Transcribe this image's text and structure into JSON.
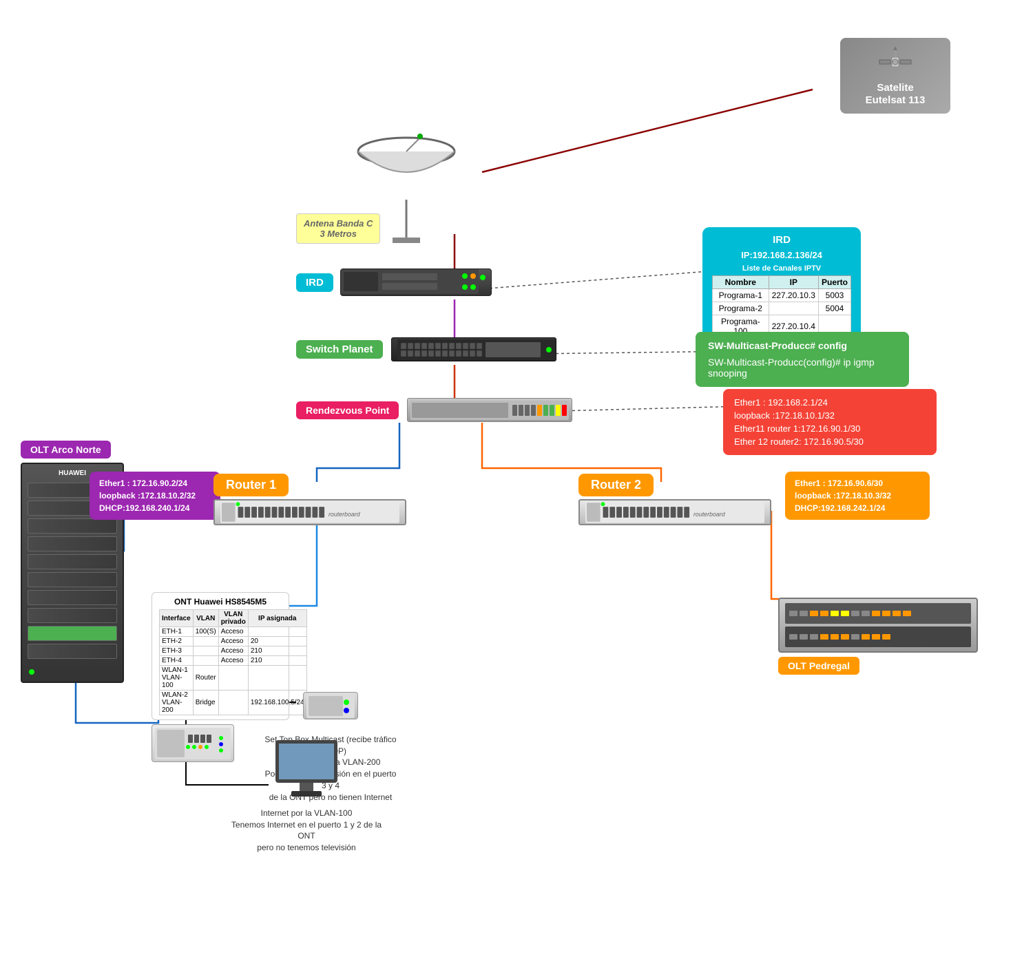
{
  "satellite": {
    "label": "Satelite\nEutelsat 113"
  },
  "antenna": {
    "label": "Antena Banda C\n3 Metros"
  },
  "ird": {
    "badge": "IRD",
    "info_title": "IRD",
    "ip": "IP:192.168.2.136/24",
    "table_title": "Liste de Canales IPTV",
    "columns": [
      "Nombre",
      "IP",
      "Puerto"
    ],
    "rows": [
      [
        "Programa-1",
        "227.20.10.3",
        "5003"
      ],
      [
        "Programa-2",
        "",
        "",
        "5004"
      ],
      [
        "Programa-100",
        "227.20.10.4",
        ""
      ]
    ]
  },
  "switch_planet": {
    "badge": "Switch Planet",
    "config_line1": "SW-Multicast-Producc# config",
    "config_line2": "SW-Multicast-Producc(config)# ip igmp snooping"
  },
  "rendezvous_point": {
    "badge": "Rendezvous Point",
    "line1": "Ether1 : 192.168.2.1/24",
    "line2": "loopback :172.18.10.1/32",
    "line3": "Ether11 router 1:172.16.90.1/30",
    "line4": "Ether 12 router2: 172.16.90.5/30"
  },
  "router1": {
    "badge": "Router  1",
    "info": {
      "line1": "Ether1 : 172.16.90.2/24",
      "line2": "loopback :172.18.10.2/32",
      "line3": "DHCP:192.168.240.1/24"
    }
  },
  "router2": {
    "badge": "Router  2",
    "info": {
      "line1": "Ether1 : 172.16.90.6/30",
      "line2": "loopback :172.18.10.3/32",
      "line3": "DHCP:192.168.242.1/24"
    }
  },
  "olt_norte": {
    "badge": "OLT Arco Norte"
  },
  "olt_pedregal": {
    "badge": "OLT Pedregal"
  },
  "ont": {
    "title": "ONT Huawei HS8545M5",
    "table": {
      "headers": [
        "Interface",
        "VLAN",
        "VLAN privado",
        "IP asignada"
      ],
      "rows": [
        [
          "ETH-1",
          "100(S)",
          "Acceso",
          ""
        ],
        [
          "ETH-2",
          "",
          "Acceso",
          "20"
        ],
        [
          "ETH-3",
          "",
          "Acceso",
          "210"
        ],
        [
          "ETH-4",
          "",
          "Acceso",
          "210"
        ],
        [
          "WLAN-1 VLAN-100",
          "Router",
          "",
          ""
        ],
        [
          "WLAN-2 VLAN-200",
          "Bridge",
          "",
          "192.168.100.5/24"
        ]
      ]
    }
  },
  "stb": {
    "info": "Set Top Box Multicast (recibe tráfico en UDP)\nTelevision por la VLAN-200\nPodemos ver televisión en el puerto 3 y 4\nde la ONT pero no tienen Internet"
  },
  "computer": {
    "label": "Internet por la VLAN-100\nTenemos Internet en el puerto 1 y 2 de la ONT\npero no tenemos televisión"
  }
}
